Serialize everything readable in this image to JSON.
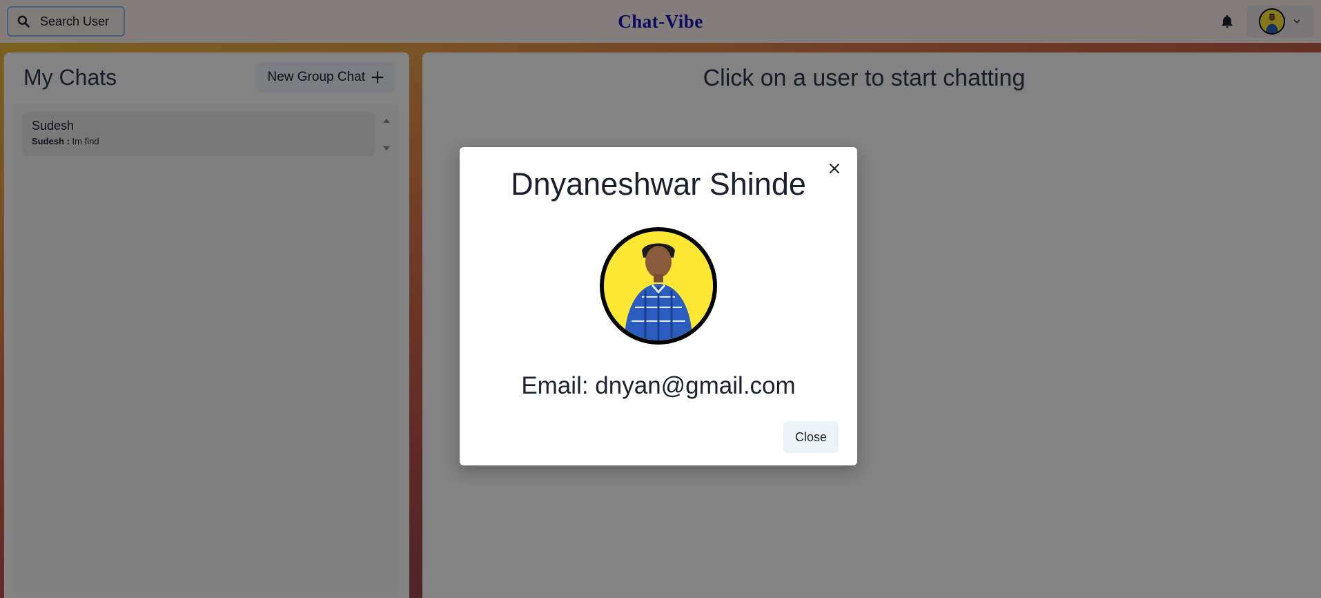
{
  "header": {
    "search_label": "Search User",
    "brand": "Chat-Vibe",
    "icons": {
      "search": "search-icon",
      "bell": "bell-icon",
      "chevron": "chevron-down-icon"
    }
  },
  "sidebar": {
    "title": "My Chats",
    "new_group_label": "New Group Chat",
    "chats": [
      {
        "name": "Sudesh",
        "sender": "Sudesh :",
        "preview": "Im find"
      }
    ]
  },
  "main": {
    "empty_message": "Click on a user to start chatting"
  },
  "profile_modal": {
    "name": "Dnyaneshwar Shinde",
    "email": "Email: dnyan@gmail.com",
    "close_label": "Close"
  },
  "colors": {
    "brand": "#1a0fb8",
    "avatar_bg": "#ffe833",
    "shirt": "#2a5dbf"
  }
}
